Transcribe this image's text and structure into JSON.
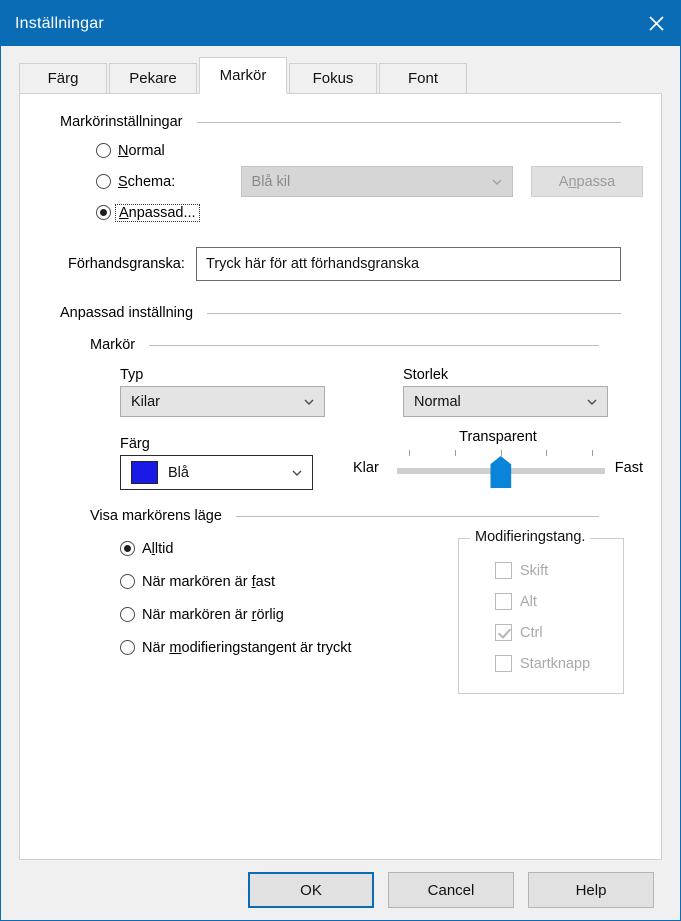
{
  "window": {
    "title": "Inställningar",
    "close_icon": "close-icon"
  },
  "tabs": [
    {
      "label": "Färg",
      "active": false
    },
    {
      "label": "Pekare",
      "active": false
    },
    {
      "label": "Markör",
      "active": true
    },
    {
      "label": "Fokus",
      "active": false
    },
    {
      "label": "Font",
      "active": false
    }
  ],
  "cursor_settings": {
    "header": "Markörinställningar",
    "options": [
      {
        "label_before": "",
        "mnemonic": "N",
        "label_after": "ormal",
        "selected": false,
        "focused": false
      },
      {
        "label_before": "",
        "mnemonic": "S",
        "label_after": "chema:",
        "selected": false,
        "focused": false
      },
      {
        "label_before": "",
        "mnemonic": "A",
        "label_after": "npassad...",
        "selected": true,
        "focused": true
      }
    ],
    "scheme_combo_value": "Blå kil",
    "scheme_combo_disabled": true,
    "customize_button": {
      "label_before": "A",
      "mnemonic": "n",
      "label_after": "passa",
      "disabled": true
    }
  },
  "preview": {
    "label": "Förhandsgranska:",
    "value": "Tryck här för att förhandsgranska"
  },
  "custom_setting": {
    "header": "Anpassad inställning",
    "cursor_group_header": "Markör",
    "type": {
      "label": "Typ",
      "value": "Kilar"
    },
    "size": {
      "label": "Storlek",
      "value": "Normal"
    },
    "color": {
      "label": "Färg",
      "value": "Blå",
      "swatch_hex": "#1a1ae6"
    },
    "transparency": {
      "title": "Transparent",
      "min_label": "Klar",
      "max_label": "Fast",
      "value_percent": 50,
      "tick_count": 5
    }
  },
  "show_position": {
    "header": "Visa markörens läge",
    "options": [
      {
        "label_before": "A",
        "mnemonic": "l",
        "label_after": "ltid",
        "selected": true
      },
      {
        "label_before": "När markören är ",
        "mnemonic": "f",
        "label_after": "ast",
        "selected": false
      },
      {
        "label_before": "När markören är ",
        "mnemonic": "r",
        "label_after": "örlig",
        "selected": false
      },
      {
        "label_before": "När ",
        "mnemonic": "m",
        "label_after": "odifieringstangent är tryckt",
        "selected": false
      }
    ],
    "modifier_group": {
      "title": "Modifieringstang.",
      "disabled": true,
      "items": [
        {
          "label": "Skift",
          "checked": false
        },
        {
          "label": "Alt",
          "checked": false
        },
        {
          "label": "Ctrl",
          "checked": true
        },
        {
          "label": "Startknapp",
          "checked": false
        }
      ]
    }
  },
  "footer": {
    "ok": "OK",
    "cancel": "Cancel",
    "help": "Help"
  },
  "colors": {
    "titlebar": "#0a6cb4",
    "accent": "#0a84d8",
    "panel": "#ffffff",
    "dialog": "#f0f0f0"
  }
}
